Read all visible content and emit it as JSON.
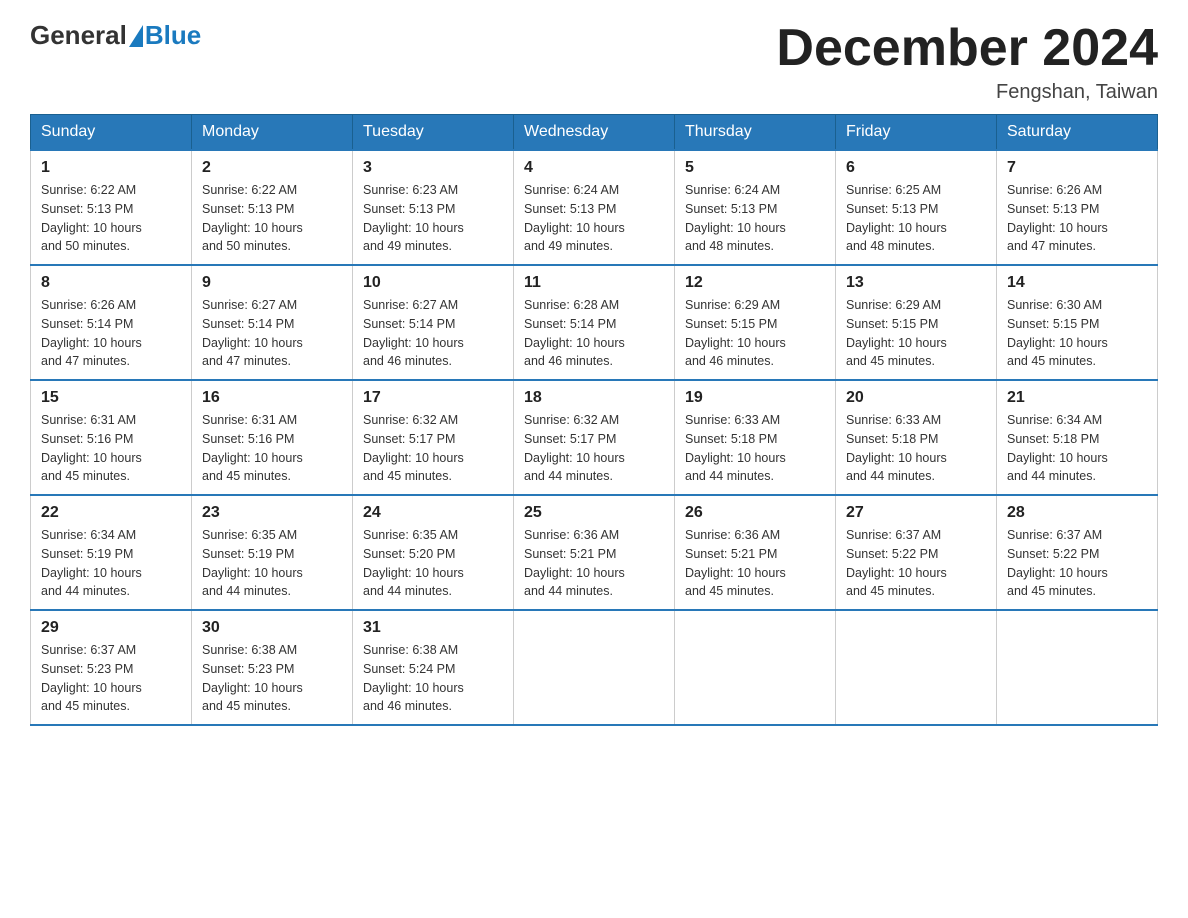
{
  "header": {
    "logo_general": "General",
    "logo_blue": "Blue",
    "month_title": "December 2024",
    "location": "Fengshan, Taiwan"
  },
  "days_of_week": [
    "Sunday",
    "Monday",
    "Tuesday",
    "Wednesday",
    "Thursday",
    "Friday",
    "Saturday"
  ],
  "weeks": [
    [
      {
        "day": "1",
        "sunrise": "6:22 AM",
        "sunset": "5:13 PM",
        "daylight": "10 hours and 50 minutes."
      },
      {
        "day": "2",
        "sunrise": "6:22 AM",
        "sunset": "5:13 PM",
        "daylight": "10 hours and 50 minutes."
      },
      {
        "day": "3",
        "sunrise": "6:23 AM",
        "sunset": "5:13 PM",
        "daylight": "10 hours and 49 minutes."
      },
      {
        "day": "4",
        "sunrise": "6:24 AM",
        "sunset": "5:13 PM",
        "daylight": "10 hours and 49 minutes."
      },
      {
        "day": "5",
        "sunrise": "6:24 AM",
        "sunset": "5:13 PM",
        "daylight": "10 hours and 48 minutes."
      },
      {
        "day": "6",
        "sunrise": "6:25 AM",
        "sunset": "5:13 PM",
        "daylight": "10 hours and 48 minutes."
      },
      {
        "day": "7",
        "sunrise": "6:26 AM",
        "sunset": "5:13 PM",
        "daylight": "10 hours and 47 minutes."
      }
    ],
    [
      {
        "day": "8",
        "sunrise": "6:26 AM",
        "sunset": "5:14 PM",
        "daylight": "10 hours and 47 minutes."
      },
      {
        "day": "9",
        "sunrise": "6:27 AM",
        "sunset": "5:14 PM",
        "daylight": "10 hours and 47 minutes."
      },
      {
        "day": "10",
        "sunrise": "6:27 AM",
        "sunset": "5:14 PM",
        "daylight": "10 hours and 46 minutes."
      },
      {
        "day": "11",
        "sunrise": "6:28 AM",
        "sunset": "5:14 PM",
        "daylight": "10 hours and 46 minutes."
      },
      {
        "day": "12",
        "sunrise": "6:29 AM",
        "sunset": "5:15 PM",
        "daylight": "10 hours and 46 minutes."
      },
      {
        "day": "13",
        "sunrise": "6:29 AM",
        "sunset": "5:15 PM",
        "daylight": "10 hours and 45 minutes."
      },
      {
        "day": "14",
        "sunrise": "6:30 AM",
        "sunset": "5:15 PM",
        "daylight": "10 hours and 45 minutes."
      }
    ],
    [
      {
        "day": "15",
        "sunrise": "6:31 AM",
        "sunset": "5:16 PM",
        "daylight": "10 hours and 45 minutes."
      },
      {
        "day": "16",
        "sunrise": "6:31 AM",
        "sunset": "5:16 PM",
        "daylight": "10 hours and 45 minutes."
      },
      {
        "day": "17",
        "sunrise": "6:32 AM",
        "sunset": "5:17 PM",
        "daylight": "10 hours and 45 minutes."
      },
      {
        "day": "18",
        "sunrise": "6:32 AM",
        "sunset": "5:17 PM",
        "daylight": "10 hours and 44 minutes."
      },
      {
        "day": "19",
        "sunrise": "6:33 AM",
        "sunset": "5:18 PM",
        "daylight": "10 hours and 44 minutes."
      },
      {
        "day": "20",
        "sunrise": "6:33 AM",
        "sunset": "5:18 PM",
        "daylight": "10 hours and 44 minutes."
      },
      {
        "day": "21",
        "sunrise": "6:34 AM",
        "sunset": "5:18 PM",
        "daylight": "10 hours and 44 minutes."
      }
    ],
    [
      {
        "day": "22",
        "sunrise": "6:34 AM",
        "sunset": "5:19 PM",
        "daylight": "10 hours and 44 minutes."
      },
      {
        "day": "23",
        "sunrise": "6:35 AM",
        "sunset": "5:19 PM",
        "daylight": "10 hours and 44 minutes."
      },
      {
        "day": "24",
        "sunrise": "6:35 AM",
        "sunset": "5:20 PM",
        "daylight": "10 hours and 44 minutes."
      },
      {
        "day": "25",
        "sunrise": "6:36 AM",
        "sunset": "5:21 PM",
        "daylight": "10 hours and 44 minutes."
      },
      {
        "day": "26",
        "sunrise": "6:36 AM",
        "sunset": "5:21 PM",
        "daylight": "10 hours and 45 minutes."
      },
      {
        "day": "27",
        "sunrise": "6:37 AM",
        "sunset": "5:22 PM",
        "daylight": "10 hours and 45 minutes."
      },
      {
        "day": "28",
        "sunrise": "6:37 AM",
        "sunset": "5:22 PM",
        "daylight": "10 hours and 45 minutes."
      }
    ],
    [
      {
        "day": "29",
        "sunrise": "6:37 AM",
        "sunset": "5:23 PM",
        "daylight": "10 hours and 45 minutes."
      },
      {
        "day": "30",
        "sunrise": "6:38 AM",
        "sunset": "5:23 PM",
        "daylight": "10 hours and 45 minutes."
      },
      {
        "day": "31",
        "sunrise": "6:38 AM",
        "sunset": "5:24 PM",
        "daylight": "10 hours and 46 minutes."
      },
      null,
      null,
      null,
      null
    ]
  ],
  "labels": {
    "sunrise": "Sunrise:",
    "sunset": "Sunset:",
    "daylight": "Daylight:"
  }
}
